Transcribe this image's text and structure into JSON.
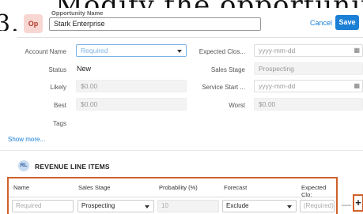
{
  "background_text": {
    "line1": "Modify the opportunity fields",
    "line2": "3."
  },
  "header": {
    "avatar": "Op",
    "name_label": "Opportunity Name",
    "name_value": "Stark Enterprise",
    "cancel": "Cancel",
    "save": "Save"
  },
  "fields": {
    "account_name": {
      "label": "Account Name",
      "placeholder": "Required"
    },
    "expected_close": {
      "label": "Expected Clos...",
      "placeholder": "yyyy-mm-dd"
    },
    "status": {
      "label": "Status",
      "value": "New"
    },
    "sales_stage": {
      "label": "Sales Stage",
      "value": "Prospecting"
    },
    "likely": {
      "label": "Likely",
      "value": "$0.00"
    },
    "service_start": {
      "label": "Service Start ...",
      "placeholder": "yyyy-mm-dd"
    },
    "best": {
      "label": "Best",
      "value": "$0.00"
    },
    "worst": {
      "label": "Worst",
      "value": "$0.00"
    },
    "tags": {
      "label": "Tags"
    }
  },
  "show_more": "Show more...",
  "rli": {
    "badge": "RL",
    "title": "REVENUE LINE ITEMS",
    "columns": [
      "Name",
      "Sales Stage",
      "Probability (%)",
      "Forecast",
      "Expected Clo:"
    ],
    "row": {
      "name_placeholder": "Required",
      "sales_stage": "Prospecting",
      "probability": "10",
      "forecast": "Exclude",
      "expected_close_placeholder": "(Required) y"
    },
    "remove": "—",
    "add": "+"
  },
  "colors": {
    "accent": "#1b7fd6",
    "highlight": "#d0602a"
  },
  "icons": [
    "calendar-icon",
    "chevron-down-icon"
  ]
}
